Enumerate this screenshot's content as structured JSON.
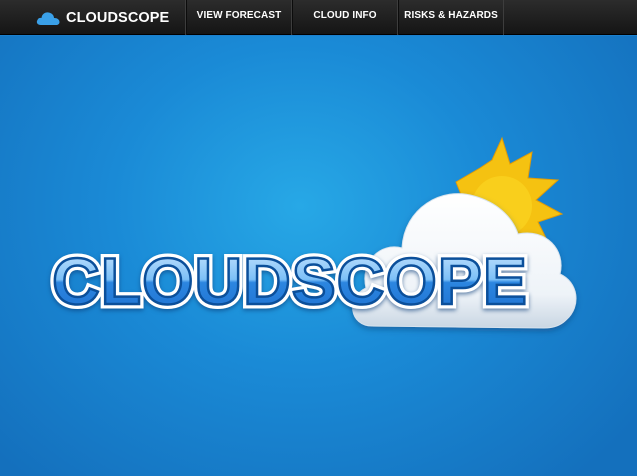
{
  "app": {
    "brand_name": "CLOUDSCOPE",
    "brand_icon": "cloud-icon"
  },
  "nav": {
    "items": [
      {
        "label": "VIEW FORECAST"
      },
      {
        "label": "CLOUD INFO"
      },
      {
        "label": "RISKS & HAZARDS"
      }
    ]
  },
  "hero": {
    "logo_text": "CLOUDSCOPE",
    "logo_art": "cloud-with-sun-logo"
  },
  "colors": {
    "navbar": "#1f1f1f",
    "background": "#1a8ad6",
    "logo_text_fill": "#5aa8f0",
    "logo_outline": "#0b4f9a",
    "sun": "#f7c515"
  }
}
